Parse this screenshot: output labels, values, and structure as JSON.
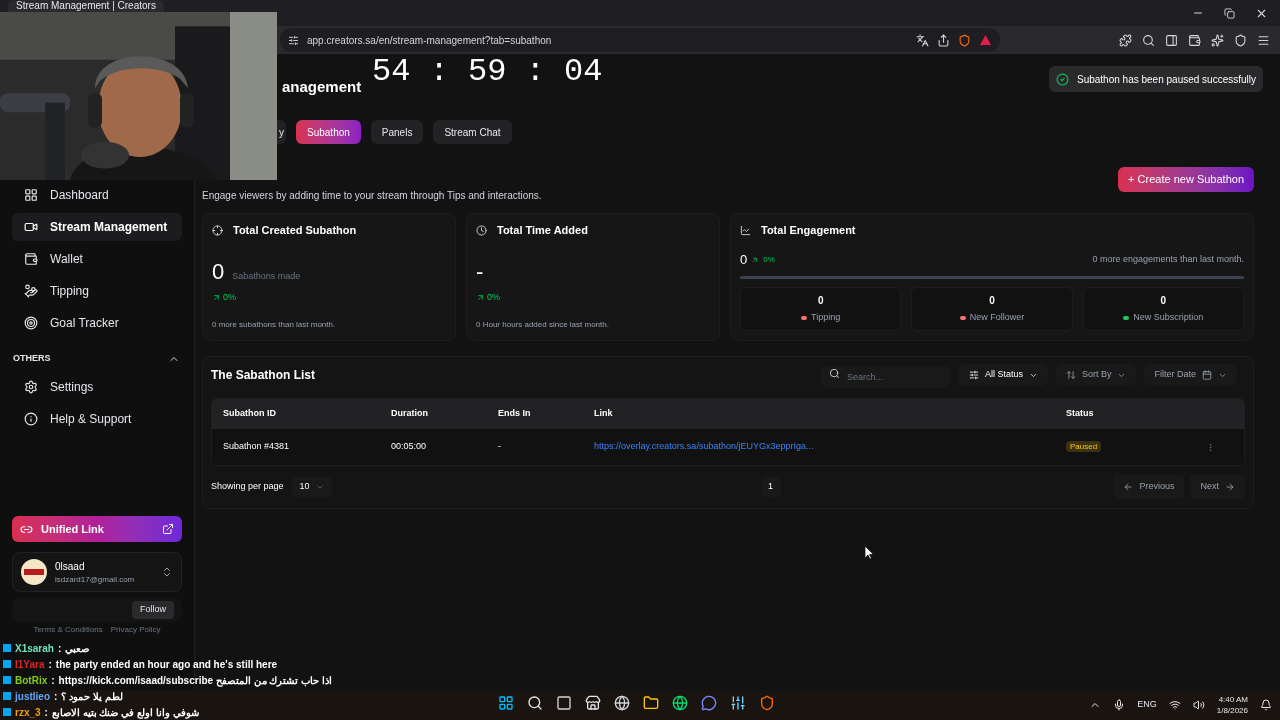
{
  "browser": {
    "tab_title": "Stream Management | Creators",
    "url": "app.creators.sa/en/stream-management?tab=subathon"
  },
  "timer": "54 : 59 : 04",
  "toast": "Subathon has been paused successfully",
  "sidebar": {
    "items": [
      {
        "label": "Dashboard",
        "selected": false
      },
      {
        "label": "Stream Management",
        "selected": true
      },
      {
        "label": "Wallet",
        "selected": false
      },
      {
        "label": "Tipping",
        "selected": false
      },
      {
        "label": "Goal Tracker",
        "selected": false
      }
    ],
    "section": {
      "title": "OTHERS",
      "expanded": true,
      "items": [
        {
          "label": "Settings",
          "selected": false
        },
        {
          "label": "Help & Support",
          "selected": false
        }
      ]
    },
    "unified_link": "Unified Link",
    "user": {
      "name": "0lsaad",
      "email": "isdzard17@gmail.com"
    },
    "follow_button": "Follow",
    "footer_links": [
      "Terms & Conditions",
      "Privacy Policy"
    ]
  },
  "page": {
    "title": "anagement",
    "tabs": [
      {
        "label": "y",
        "selected": false
      },
      {
        "label": "Subathon",
        "selected": true
      },
      {
        "label": "Panels",
        "selected": false
      },
      {
        "label": "Stream Chat",
        "selected": false
      }
    ],
    "description": "Engage viewers by adding time to your stream through Tips and interactions.",
    "create_button": "+ Create new Subathon",
    "stats": [
      {
        "title": "Total Created Subathon",
        "value": "0",
        "caption": "Sabathons made",
        "change": "0%",
        "note": "0 more subathons than last month."
      },
      {
        "title": "Total Time Added",
        "value": "-",
        "change": "0%",
        "note": "0 Hour hours added since last month."
      }
    ],
    "engagement": {
      "title": "Total Engagement",
      "value": "0",
      "change": "0%",
      "note": "0 more engagements than last month.",
      "items": [
        {
          "value": "0",
          "label": "Tipping",
          "color": "#f87171"
        },
        {
          "value": "0",
          "label": "New Follower",
          "color": "#f87171"
        },
        {
          "value": "0",
          "label": "New Subscription",
          "color": "#22c55e"
        }
      ]
    },
    "list": {
      "title": "The Sabathon List",
      "search_placeholder": "Search...",
      "filters": [
        "All Status",
        "Sort By",
        "Filter Date"
      ],
      "columns": [
        "Subathon ID",
        "Duration",
        "Ends In",
        "Link",
        "Status"
      ],
      "rows": [
        {
          "id": "Subathon #4381",
          "duration": "00:05:00",
          "ends_in": "-",
          "link": "https://overlay.creators.sa/subathon/jEUYGx3epprIga...",
          "status": "Paused"
        }
      ],
      "per_page_label": "Showing per page",
      "per_page": "10",
      "page": "1",
      "previous": "Previous",
      "next": "Next"
    }
  },
  "chat": {
    "separator": ":",
    "messages": [
      {
        "user": "X1sarah",
        "color": "#6ee7b7",
        "message": "صعبي"
      },
      {
        "user": "l1Yara",
        "color": "#dc2626",
        "message": "the party ended an hour ago and he's still here"
      },
      {
        "user": "BotRix",
        "color": "#84cc16",
        "message": "اذا حاب تشترك من المتصفح https://kick.com/isaad/subscribe"
      },
      {
        "user": "justlieo",
        "color": "#60a5fa",
        "message": "لطم يلا حمود ؟"
      },
      {
        "user": "rzx_3",
        "color": "#f59e0b",
        "message": "شوفي وانا اولع في ضنك بتيه الاصابع"
      }
    ]
  },
  "taskbar": {
    "language": "ENG",
    "time": "4:40 AM",
    "date": "1/8/2026"
  }
}
